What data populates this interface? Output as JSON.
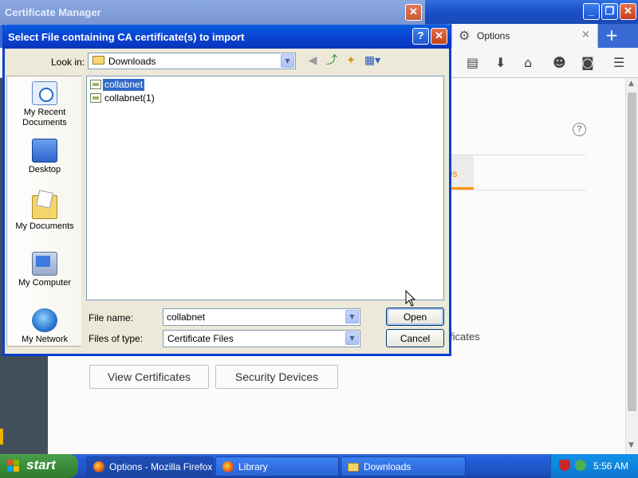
{
  "firefox": {
    "tab_title": "Options",
    "tab_close": "×",
    "new_tab": "+",
    "window_controls": {
      "minimize": "_",
      "maximize": "❐",
      "close": "✕"
    },
    "toolbar_icons": [
      "reader-list-icon",
      "download-icon",
      "home-icon",
      "smiley-icon",
      "pocket-icon",
      "menu-icon"
    ],
    "content_tab_label": "es",
    "certificates_text": "ficates",
    "help_label": "?",
    "view_certificates": "View Certificates",
    "security_devices": "Security Devices",
    "accent_color": "#ff9400"
  },
  "cert_manager": {
    "title": "Certificate Manager",
    "close": "✕"
  },
  "dialog": {
    "title": "Select File containing CA certificate(s) to import",
    "help": "?",
    "close": "✕",
    "look_in_label": "Look in:",
    "look_in_value": "Downloads",
    "places": [
      {
        "label": "My Recent Documents",
        "icon": "recent-documents-icon"
      },
      {
        "label": "Desktop",
        "icon": "desktop-icon"
      },
      {
        "label": "My Documents",
        "icon": "my-documents-icon"
      },
      {
        "label": "My Computer",
        "icon": "my-computer-icon"
      },
      {
        "label": "My Network",
        "icon": "my-network-icon"
      }
    ],
    "files": [
      {
        "name": "collabnet",
        "selected": true
      },
      {
        "name": "collabnet(1)",
        "selected": false
      }
    ],
    "file_name_label": "File name:",
    "file_name_value": "collabnet",
    "file_type_label": "Files of type:",
    "file_type_value": "Certificate Files",
    "open_button": "Open",
    "cancel_button": "Cancel",
    "selection_color": "#316ac5"
  },
  "taskbar": {
    "start_label": "start",
    "tasks": [
      {
        "label": "Options - Mozilla Firefox",
        "icon": "firefox-icon"
      },
      {
        "label": "Library",
        "icon": "firefox-icon"
      },
      {
        "label": "Downloads",
        "icon": "folder-icon"
      }
    ],
    "clock": "5:56 AM"
  }
}
